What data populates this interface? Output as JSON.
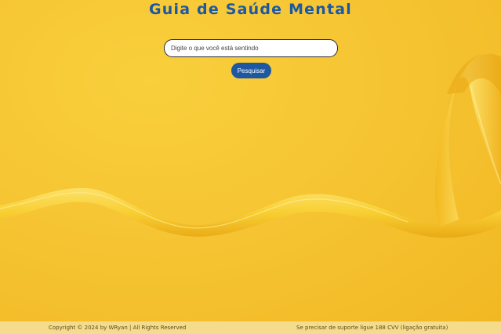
{
  "page": {
    "title": "Guia de Saúde Mental"
  },
  "search": {
    "placeholder": "Digite o que você está sentindo",
    "value": "",
    "button_label": "Pesquisar"
  },
  "footer": {
    "copyright": "Copyright © 2024 by WRyan | All Rights Reserved",
    "support": "Se precisar de suporte ligue 188 CVV (ligação gratuita)"
  },
  "colors": {
    "background": "#f6c431",
    "title": "#1d58a0",
    "button": "#1d58a0",
    "footer_bg": "#f5dc8c"
  }
}
